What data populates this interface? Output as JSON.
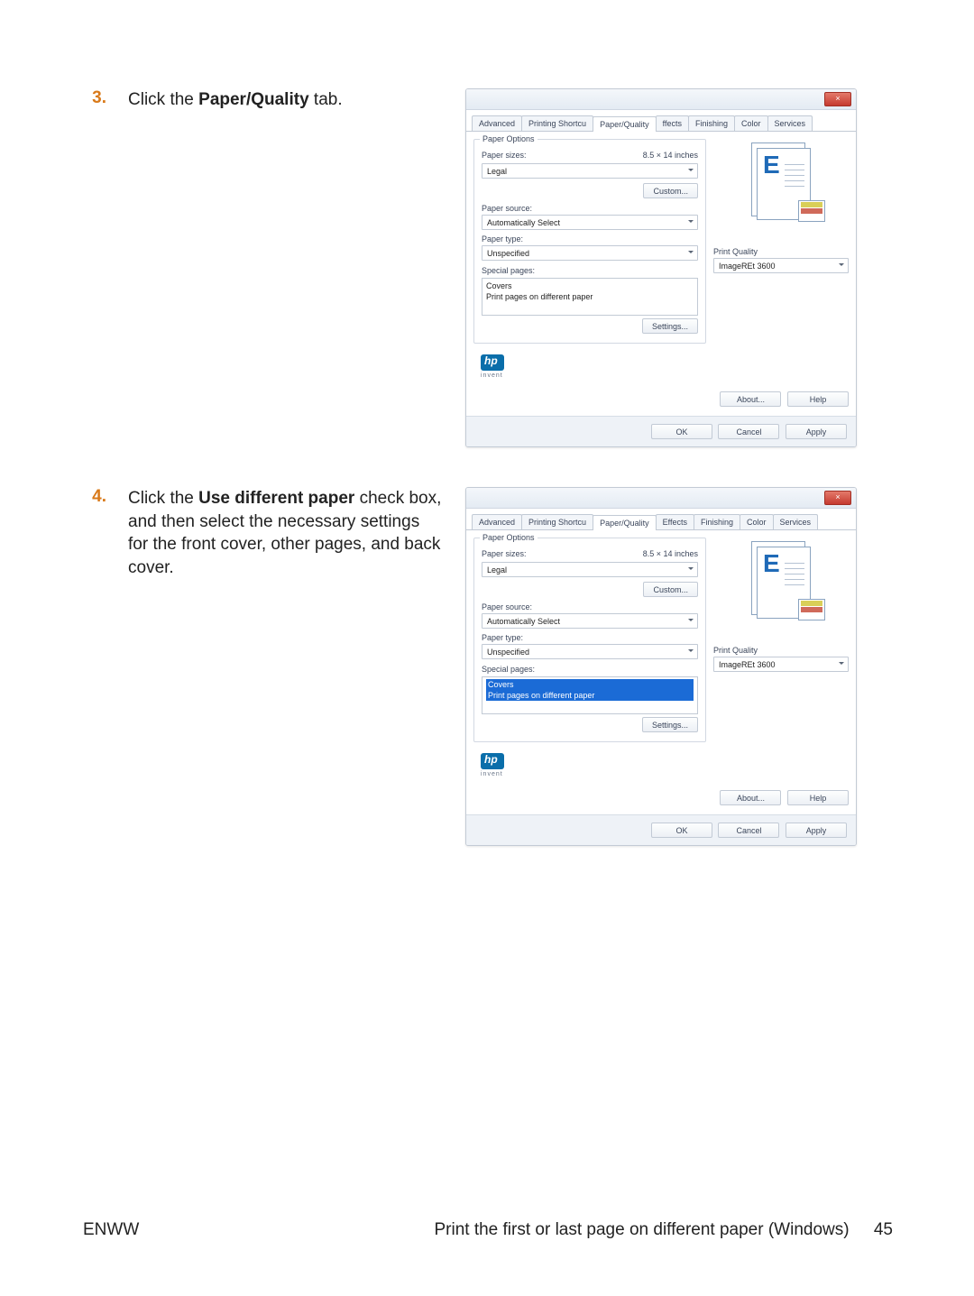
{
  "steps": {
    "s3": {
      "num": "3.",
      "pre": "Click the ",
      "bold": "Paper/Quality",
      "post": " tab."
    },
    "s4": {
      "num": "4.",
      "pre": "Click the ",
      "bold": "Use different paper",
      "post": " check box, and then select the necessary settings for the front cover, other pages, and back cover."
    }
  },
  "dlg": {
    "title": "",
    "tabs": {
      "advanced": "Advanced",
      "shortcuts": "Printing Shortcu",
      "paperq": "Paper/Quality",
      "effects": "ffects",
      "effects_full": "Effects",
      "finishing": "Finishing",
      "color": "Color",
      "services": "Services"
    },
    "grp_paper_options": "Paper Options",
    "paper_sizes": "Paper sizes:",
    "paper_sizes_val": "8.5 × 14 inches",
    "paper_size_sel": "Legal",
    "custom": "Custom...",
    "paper_source": "Paper source:",
    "paper_source_sel": "Automatically Select",
    "paper_type": "Paper type:",
    "paper_type_sel": "Unspecified",
    "special_pages": "Special pages:",
    "covers": "Covers",
    "diff_paper": "Print pages on different paper",
    "settings": "Settings...",
    "print_quality": "Print Quality",
    "pq_sel": "ImageREt 3600",
    "about": "About...",
    "help": "Help",
    "ok": "OK",
    "cancel": "Cancel",
    "apply": "Apply",
    "invent": "invent"
  },
  "footer": {
    "left": "ENWW",
    "center": "Print the first or last page on different paper (Windows)",
    "page": "45"
  }
}
